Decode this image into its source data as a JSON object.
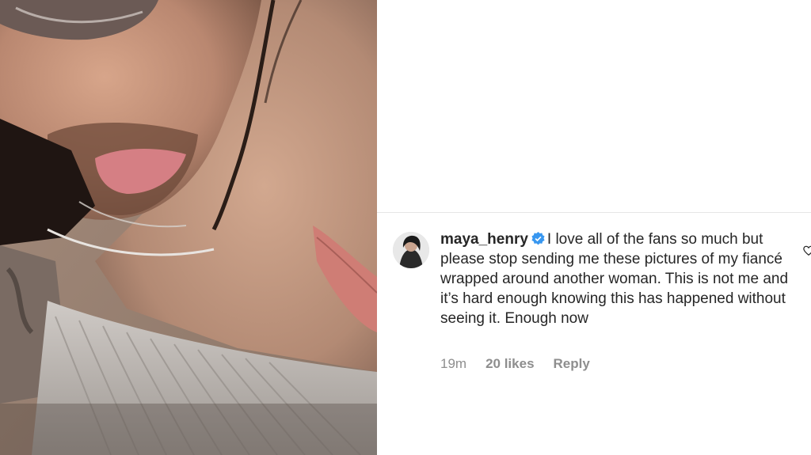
{
  "photo": {
    "description_icon": "photo-image"
  },
  "comment": {
    "username": "maya_henry",
    "text": "I love all of the fans so much but please stop sending me these pictures of my fiancé wrapped around another woman. This is not me and it’s hard enough knowing this has happened without seeing it. Enough now",
    "time": "19m",
    "likes": "20 likes",
    "reply": "Reply",
    "avatar_icon": "avatar-image",
    "verified_icon": "verified-badge-icon",
    "like_icon": "heart-icon",
    "verified_color": "#3897f0"
  }
}
